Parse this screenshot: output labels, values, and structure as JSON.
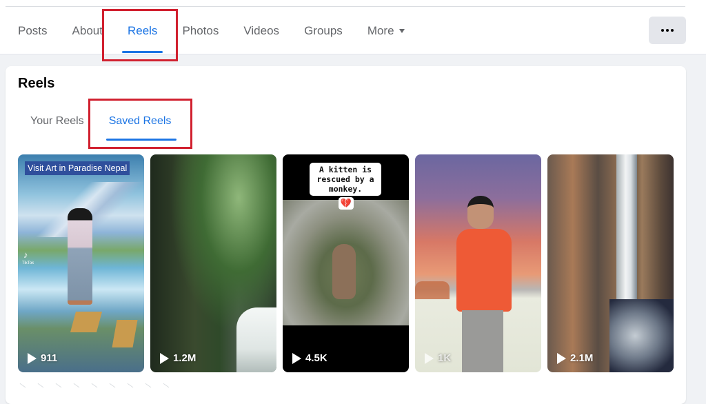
{
  "profile_nav": {
    "tabs": [
      {
        "label": "Posts",
        "active": false
      },
      {
        "label": "About",
        "active": false
      },
      {
        "label": "Reels",
        "active": true
      },
      {
        "label": "Photos",
        "active": false
      },
      {
        "label": "Videos",
        "active": false
      },
      {
        "label": "Groups",
        "active": false
      },
      {
        "label": "More",
        "active": false,
        "has_dropdown": true
      }
    ],
    "overflow_button_icon": "more-horizontal-icon",
    "accent_color": "#1b74e4",
    "highlight_color": "#d1202f"
  },
  "reels_section": {
    "title": "Reels",
    "subtabs": [
      {
        "label": "Your Reels",
        "active": false
      },
      {
        "label": "Saved Reels",
        "active": true
      }
    ],
    "reels": [
      {
        "views": "911",
        "caption": "Visit Art in Paradise Nepal",
        "watermark": "TikTok",
        "description": "painted 3D mural with waterfall and mountains"
      },
      {
        "views": "1.2M",
        "description": "jungle cliff waterfall"
      },
      {
        "views": "4.5K",
        "caption": "A kitten is rescued by a monkey.",
        "emoji": "💔",
        "description": "monkey in water well"
      },
      {
        "views": "1K",
        "description": "man in orange shirt at sunset"
      },
      {
        "views": "2.1M",
        "description": "tall waterfall in canyon"
      }
    ]
  }
}
